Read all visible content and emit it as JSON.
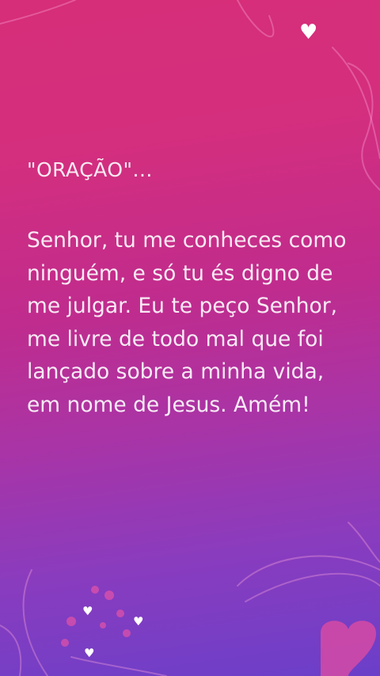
{
  "prayer": {
    "title": "\"ORAÇÃO\"...",
    "text": "Senhor, tu me conheces como ninguém, e só tu és digno de me julgar. Eu te peço Senhor, me livre de todo mal que foi lançado sobre a minha vida, em nome de Jesus. Amém!"
  },
  "icons": {
    "decoration": "heart-icon"
  },
  "colors": {
    "gradient_top": "#d62e78",
    "gradient_middle": "#bf2c8e",
    "gradient_bottom": "#6b3fc9",
    "text": "#ffffff"
  }
}
